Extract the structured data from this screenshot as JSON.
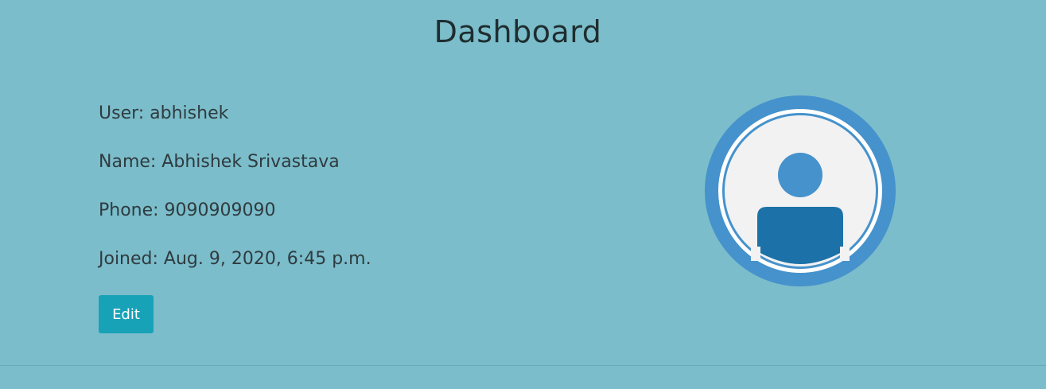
{
  "page": {
    "title": "Dashboard"
  },
  "profile": {
    "user": "User: abhishek",
    "name": "Name: Abhishek Srivastava",
    "phone": "Phone: 9090909090",
    "joined": "Joined: Aug. 9, 2020, 6:45 p.m."
  },
  "actions": {
    "edit_label": "Edit"
  },
  "avatar": {
    "icon": "user-avatar-icon"
  },
  "colors": {
    "background": "#7bbdca",
    "button": "#17a2b8",
    "avatar_ring": "#4592cc",
    "avatar_inner": "#f2f2f2",
    "avatar_body": "#1c72a8"
  }
}
